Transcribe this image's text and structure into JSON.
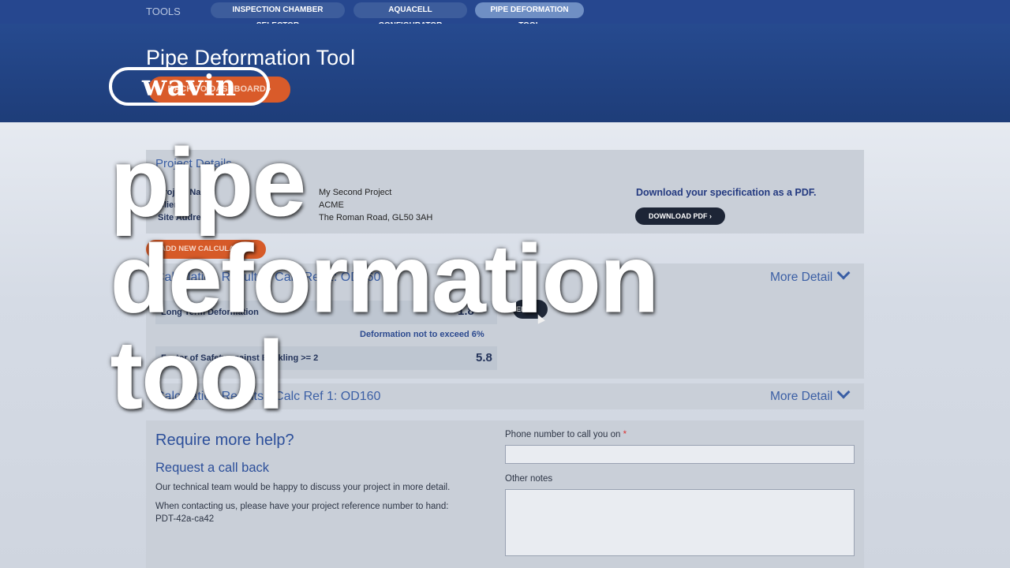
{
  "nav": {
    "tools_label": "TOOLS",
    "items": [
      "INSPECTION CHAMBER SELECTOR",
      "AQUACELL CONFIGURATOR",
      "PIPE DEFORMATION TOOL"
    ]
  },
  "header": {
    "title": "Pipe Deformation Tool",
    "back_button": "BACK TO DASHBOARD ›",
    "logo_text": "wavin"
  },
  "project": {
    "section_title": "Project Details",
    "labels": [
      "Project Name",
      "Client",
      "Site Address"
    ],
    "values": [
      "My Second Project",
      "ACME",
      "The Roman Road, GL50 3AH"
    ],
    "download_text": "Download your specification as a PDF.",
    "download_button": "DOWNLOAD PDF ›"
  },
  "add_calculation_button": "ADD NEW CALCULATION",
  "calculations": [
    {
      "title": "Calculation Results - Calc Ref 1: OD160",
      "more_detail": "More Detail",
      "rows": [
        {
          "label": "Long Term Deformation",
          "value": "1.8"
        },
        {
          "label": "Deformation not to exceed 6%",
          "value": ""
        },
        {
          "label": "Factor of Safety against Buckling >= 2",
          "value": "5.8"
        }
      ],
      "edit_button": "EDIT"
    },
    {
      "title": "Calculation Results - Calc Ref 1: OD160",
      "more_detail": "More Detail"
    }
  ],
  "help": {
    "heading": "Require more help?",
    "subheading": "Request a call back",
    "paragraph1": "Our technical team would be happy to discuss your project in more detail.",
    "paragraph2": "When contacting us, please have your project reference number to hand:",
    "reference": "PDT-42a-ca42",
    "phone_label": "Phone number to call you on",
    "required_mark": "*",
    "notes_label": "Other notes"
  },
  "overlay": {
    "line1": "pipe",
    "line2": "deformation",
    "line3": "tool"
  },
  "colors": {
    "brand_blue": "#26478f",
    "accent_orange": "#d95b2a",
    "link_blue": "#3b5fa5"
  }
}
